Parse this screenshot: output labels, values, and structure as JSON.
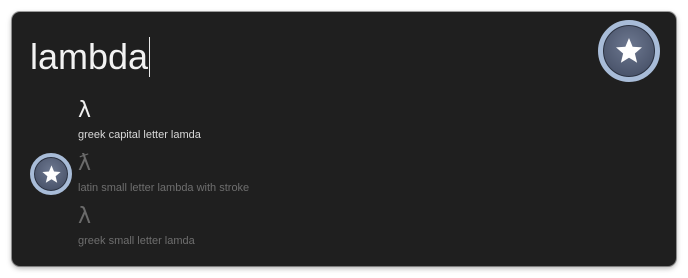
{
  "search": {
    "query": "lambda"
  },
  "icons": {
    "header_badge": "star-icon",
    "selection_badge": "star-icon"
  },
  "results": [
    {
      "glyph": "λ",
      "description": "greek capital letter lamda",
      "selected": true
    },
    {
      "glyph": "ƛ",
      "description": "latin small letter lambda with stroke",
      "selected": false
    },
    {
      "glyph": "λ",
      "description": "greek small letter lamda",
      "selected": false
    }
  ],
  "colors": {
    "panel_background": "#1f1f1f",
    "badge_ring": "#a8bcd8",
    "badge_fill": "#4c566d",
    "text_primary": "#f0f0f0",
    "text_dim": "#6e6e6e"
  }
}
